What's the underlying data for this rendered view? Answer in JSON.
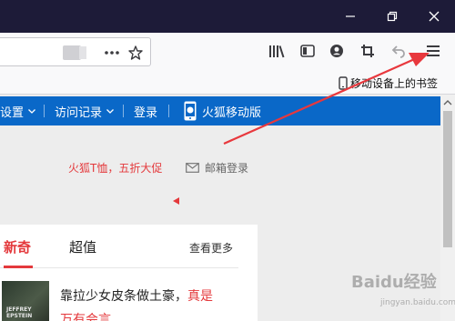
{
  "bookmarks_bar": {
    "mobile_bookmarks": "移动设备上的书签"
  },
  "site_nav": {
    "items": [
      {
        "label": "设置"
      },
      {
        "label": "访问记录"
      },
      {
        "label": "登录"
      },
      {
        "label": "火狐移动版"
      }
    ]
  },
  "page": {
    "promo_text": "火狐T恤，五折大促",
    "mail_login": "邮箱登录"
  },
  "card": {
    "tabs": [
      "新奇",
      "超值"
    ],
    "more": "查看更多",
    "headline_black": "靠拉少女皮条做土豪，",
    "headline_red": "真是",
    "headline_tail": "万有会言",
    "thumb_caption": "JEFFREY EPSTEIN"
  },
  "watermark": {
    "brand": "Baidu经验",
    "url": "jingyan.baidu.com"
  },
  "colors": {
    "titlebar": "#1d1b38",
    "nav_blue": "#0a68c8",
    "accent_red": "#e4393c",
    "annotation": "#e8383d"
  }
}
